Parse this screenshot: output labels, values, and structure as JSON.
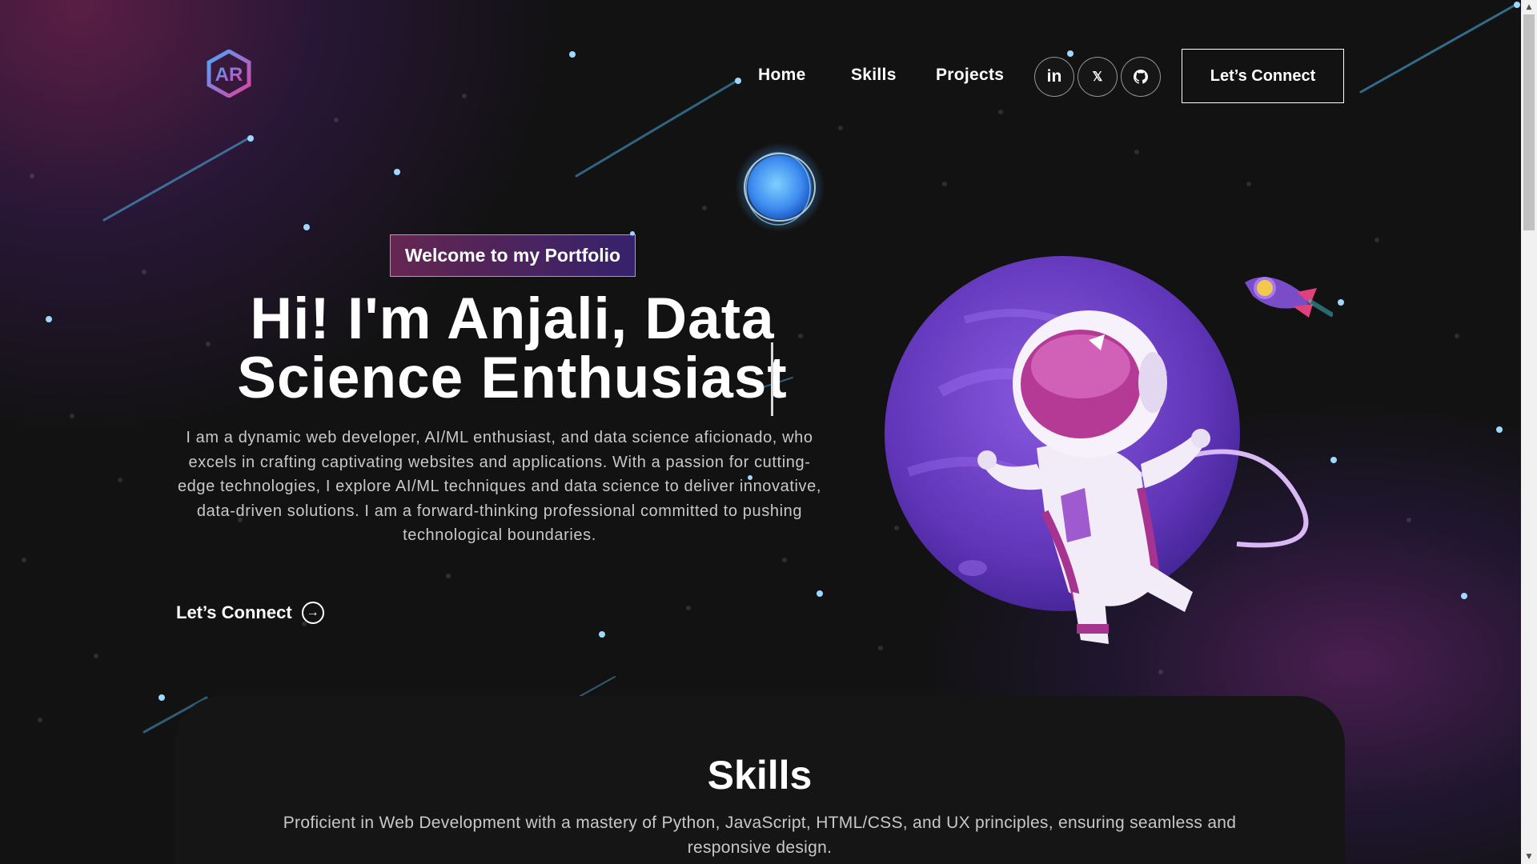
{
  "nav": {
    "links": [
      "Home",
      "Skills",
      "Projects"
    ],
    "social": [
      {
        "name": "linkedin",
        "glyph": "in"
      },
      {
        "name": "x",
        "glyph": "𝕏"
      },
      {
        "name": "github",
        "glyph": "⬤"
      }
    ],
    "connect_label": "Let’s Connect"
  },
  "logo_text": "AR",
  "hero": {
    "tagline": "Welcome to my Portfolio",
    "headline_line1": "Hi! I'm Anjali, Data",
    "headline_line2": "Science Enthusiast",
    "intro": "I am a dynamic web developer, AI/ML enthusiast, and data science aficionado, who excels in crafting captivating websites and applications. With a passion for cutting-edge technologies, I explore AI/ML techniques and data science to deliver innovative, data-driven solutions. I am a forward-thinking professional committed to pushing technological boundaries.",
    "cta_label": "Let’s Connect"
  },
  "skills": {
    "title": "Skills",
    "description": "Proficient in Web Development with a mastery of Python, JavaScript, HTML/CSS, and UX principles, ensuring seamless and responsive design."
  },
  "colors": {
    "background": "#121212",
    "accent_pink": "#aa367c",
    "accent_purple": "#4a2fbd",
    "planet": "#6b3fc0",
    "orb": "#4aa8ff"
  }
}
